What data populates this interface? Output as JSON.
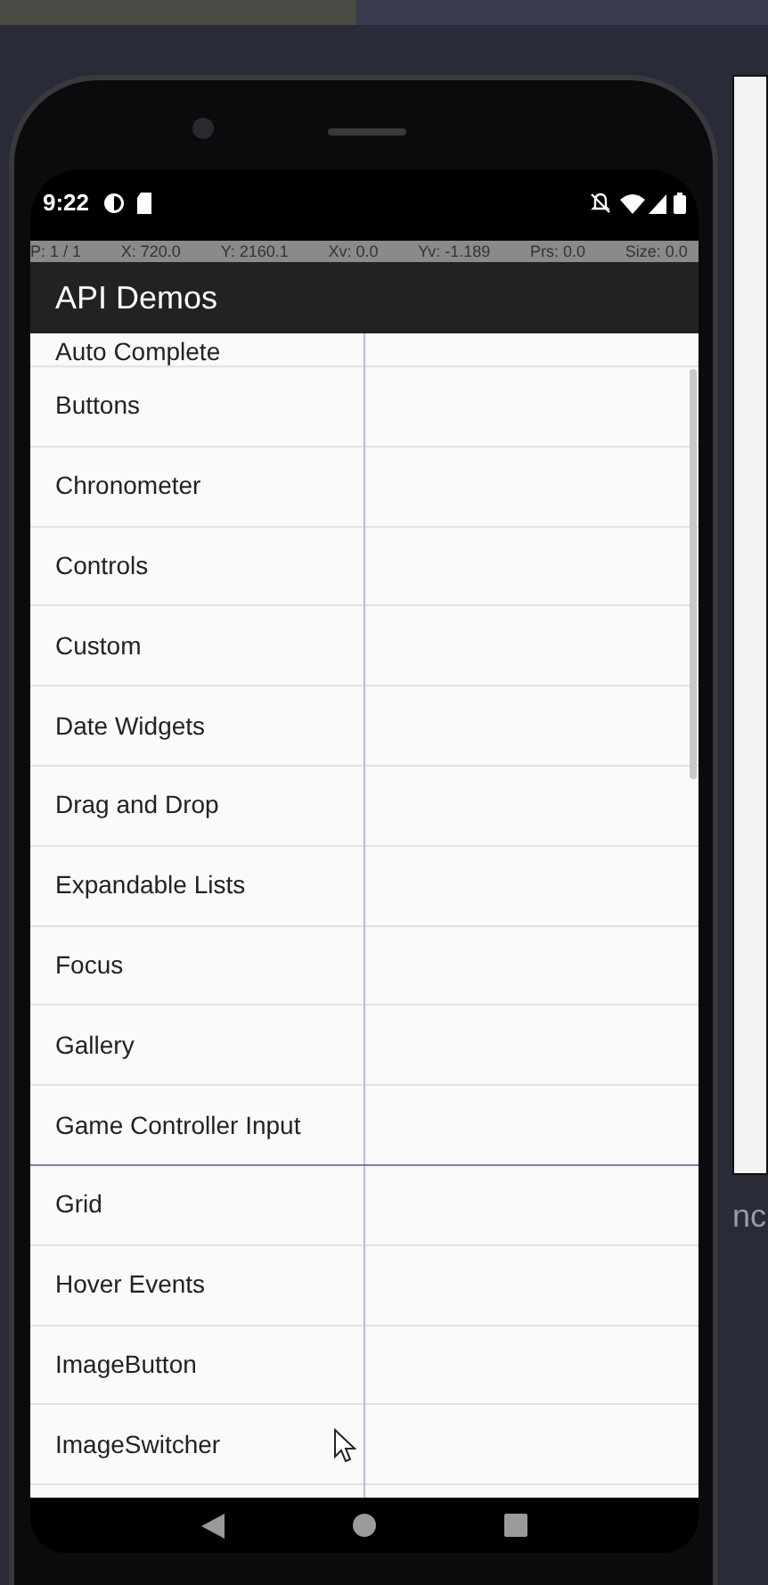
{
  "status_bar": {
    "time": "9:22"
  },
  "pointer_info": [
    "P: 1 / 1",
    "X: 720.0",
    "Y: 2160.1",
    "Xv: 0.0",
    "Yv: -1.189",
    "Prs: 0.0",
    "Size: 0.0"
  ],
  "app_bar": {
    "title": "API Demos"
  },
  "list": {
    "partial_item": "Auto Complete",
    "items": [
      "Buttons",
      "Chronometer",
      "Controls",
      "Custom",
      "Date Widgets",
      "Drag and Drop",
      "Expandable Lists",
      "Focus",
      "Gallery",
      "Game Controller Input",
      "Grid",
      "Hover Events",
      "ImageButton",
      "ImageSwitcher"
    ]
  },
  "side_panel": {
    "text": "nc"
  }
}
